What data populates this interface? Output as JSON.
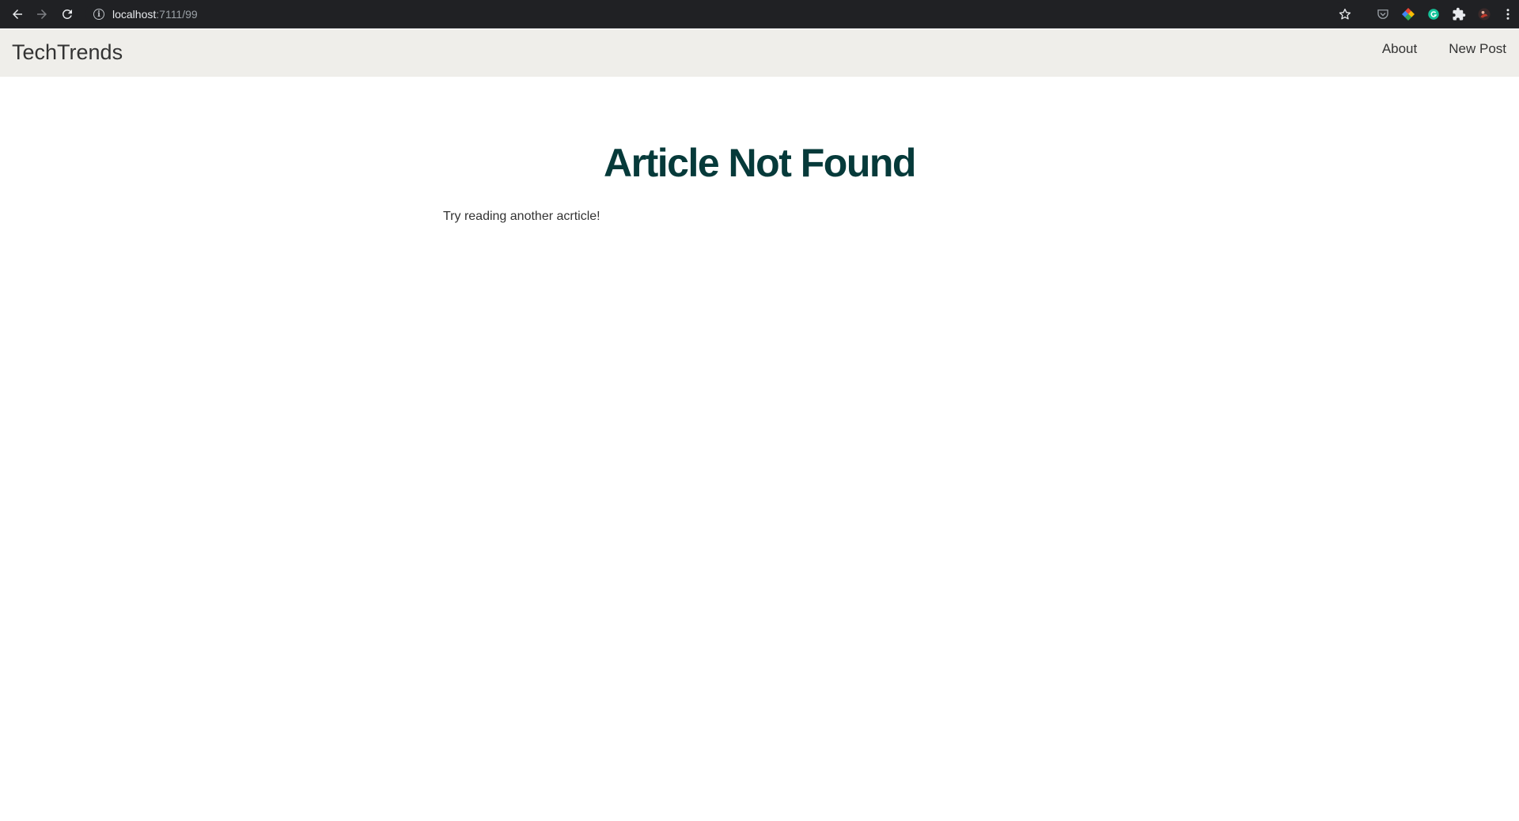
{
  "browser": {
    "url_host": "localhost",
    "url_rest": ":7111/99",
    "icons": {
      "back": "back-arrow-icon",
      "forward": "forward-arrow-icon",
      "reload": "reload-icon",
      "site_info": "info-icon",
      "bookmark": "star-icon",
      "pocket": "pocket-icon",
      "color_picker": "color-picker-icon",
      "grammarly": "grammarly-icon",
      "extensions": "puzzle-icon",
      "profile": "avatar",
      "menu": "kebab-menu-icon"
    },
    "info_glyph": "i"
  },
  "site": {
    "brand": "TechTrends",
    "nav": [
      {
        "label": "About"
      },
      {
        "label": "New Post"
      }
    ],
    "nav_bg": "#efeeea"
  },
  "content": {
    "title": "Article Not Found",
    "message": "Try reading another acrticle!",
    "title_color": "#063a3a"
  }
}
